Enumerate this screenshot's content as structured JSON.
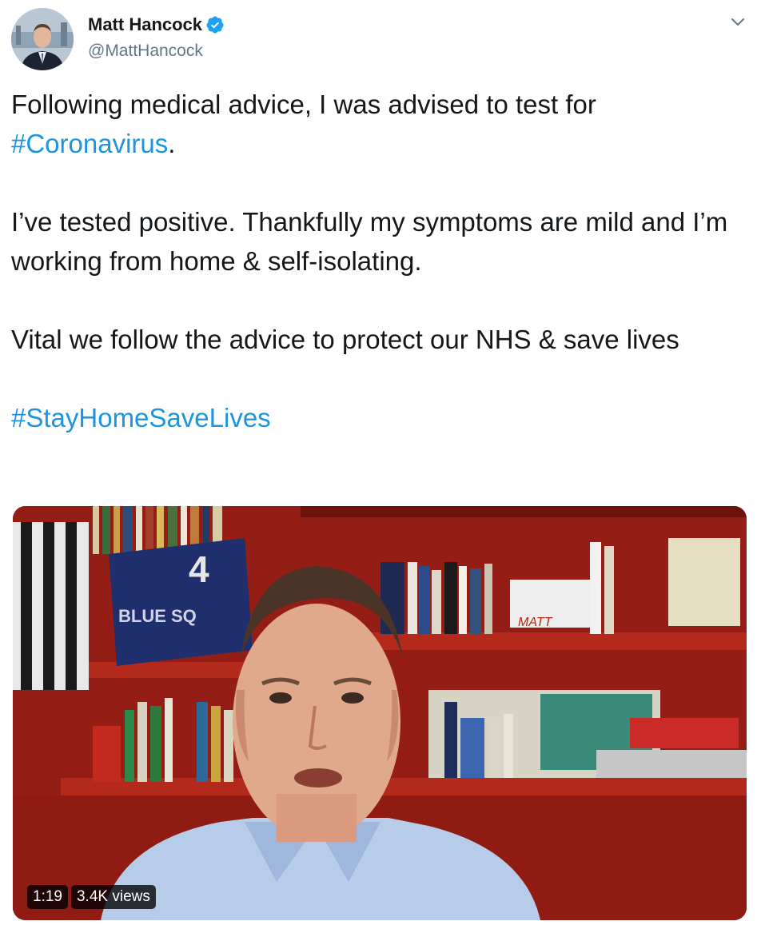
{
  "author": {
    "display_name": "Matt Hancock",
    "handle": "@MattHancock",
    "verified": true
  },
  "icons": {
    "verified": "verified-badge-icon",
    "menu": "chevron-down-icon"
  },
  "tweet": {
    "line1": "Following medical advice, I was advised to test for",
    "hashtag1": "#Coronavirus",
    "hashtag1_suffix": ".",
    "paragraph2": "I’ve tested positive. Thankfully my symptoms are mild and I’m working from home & self-isolating.",
    "paragraph3": "Vital we follow the advice to protect our NHS & save lives",
    "hashtag2": "#StayHomeSaveLives"
  },
  "video": {
    "duration": "1:19",
    "views": "3.4K views",
    "scene_text": {
      "shirt_number": "4",
      "shirt_text": "BLUE SQ",
      "box_text": "MATT"
    }
  },
  "colors": {
    "link": "#1b95e0",
    "verified": "#1da1f2",
    "text": "#14171a",
    "secondary": "#657786"
  }
}
